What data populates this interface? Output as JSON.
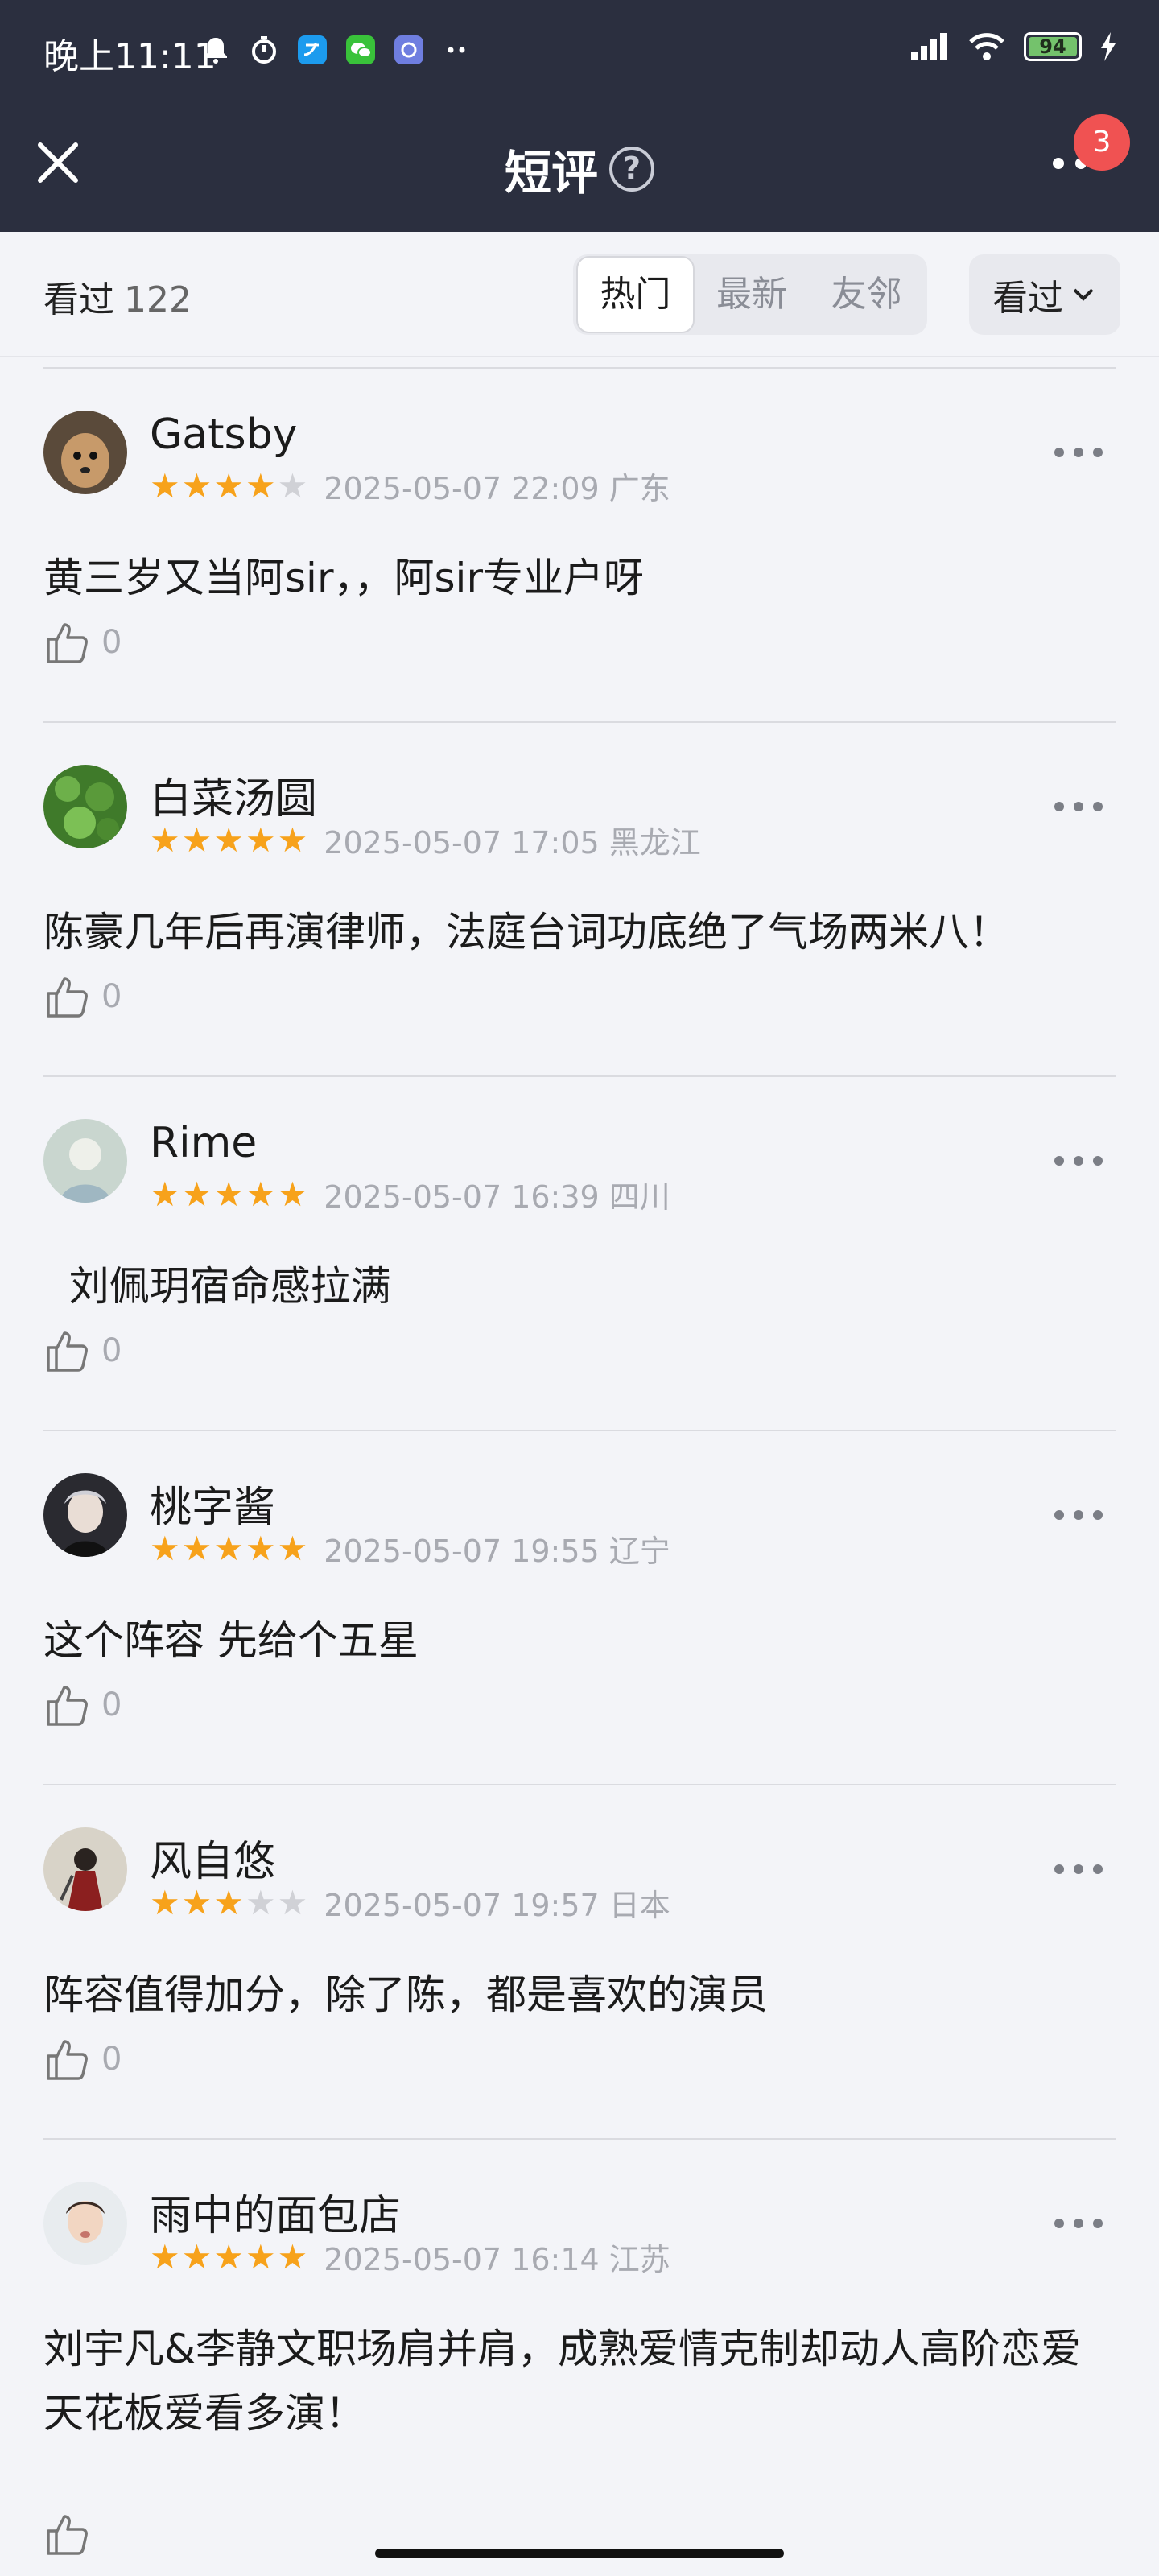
{
  "status_bar": {
    "time": "晚上11:11",
    "battery": "94"
  },
  "header": {
    "title": "短评",
    "help_glyph": "?",
    "notification_count": "3"
  },
  "filter": {
    "seen_label": "看过",
    "seen_count": "122",
    "tabs": [
      {
        "label": "热门",
        "active": true
      },
      {
        "label": "最新",
        "active": false
      },
      {
        "label": "友邻",
        "active": false
      }
    ],
    "dropdown_label": "看过"
  },
  "colors": {
    "header_bg": "#2b2f3f",
    "star_on": "#f7a21b",
    "star_off": "#d0d1d6",
    "badge": "#f05252"
  },
  "reviews": [
    {
      "user": "Gatsby",
      "stars": 4,
      "datetime": "2025-05-07 22:09 广东",
      "content": "黄三岁又当阿sir，，阿sir专业户呀",
      "likes": "0"
    },
    {
      "user": "白菜汤圆",
      "stars": 5,
      "datetime": "2025-05-07 17:05 黑龙江",
      "content": "陈豪几年后再演律师，法庭台词功底绝了气场两米八！",
      "likes": "0"
    },
    {
      "user": "Rime",
      "stars": 5,
      "datetime": "2025-05-07 16:39 四川",
      "content": "  刘佩玥宿命感拉满",
      "likes": "0"
    },
    {
      "user": "桃字酱",
      "stars": 5,
      "datetime": "2025-05-07 19:55 辽宁",
      "content": "这个阵容 先给个五星",
      "likes": "0"
    },
    {
      "user": "风自悠",
      "stars": 3,
      "datetime": "2025-05-07 19:57 日本",
      "content": "阵容值得加分，除了陈，都是喜欢的演员",
      "likes": "0"
    },
    {
      "user": "雨中的面包店",
      "stars": 5,
      "datetime": "2025-05-07 16:14 江苏",
      "content": "刘宇凡&李静文职场肩并肩，成熟爱情克制却动人高阶恋爱天花板爱看多演！",
      "likes": ""
    }
  ]
}
